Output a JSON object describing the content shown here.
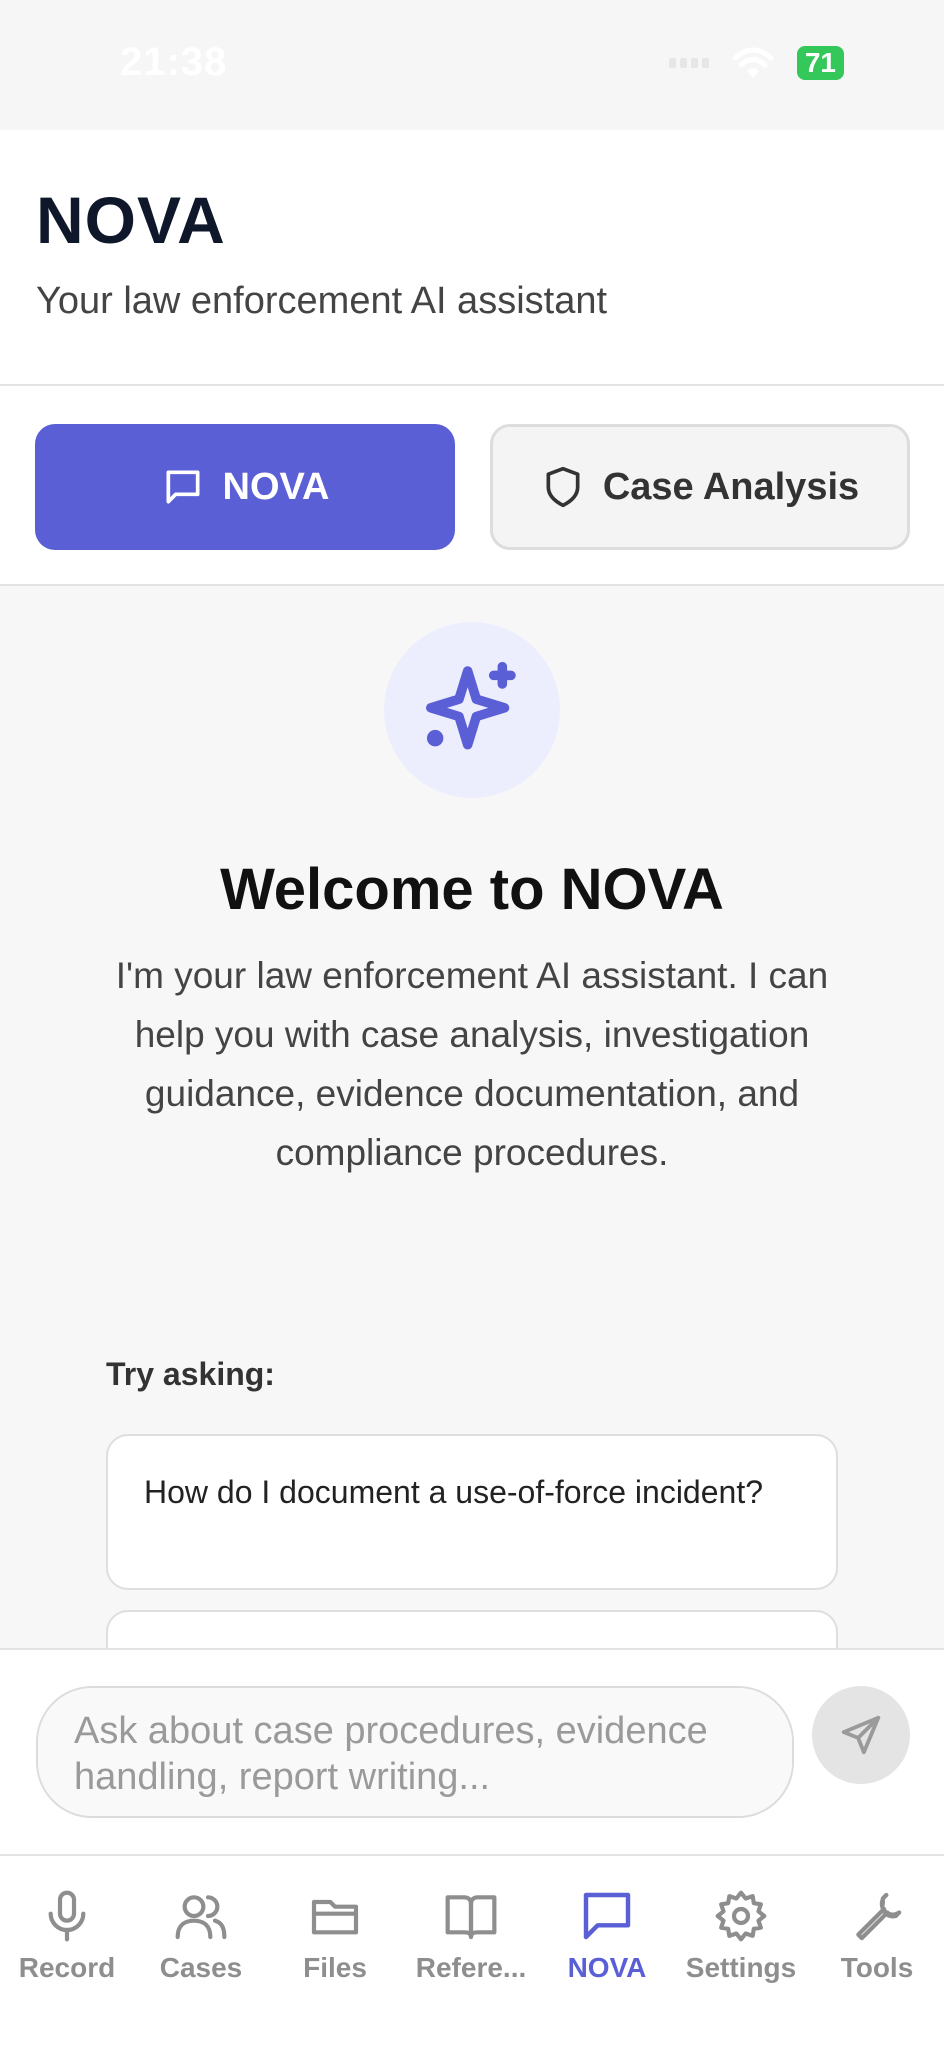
{
  "status_bar": {
    "time": "21:38",
    "battery": "71"
  },
  "header": {
    "title": "NOVA",
    "subtitle": "Your law enforcement AI assistant"
  },
  "tabs": [
    {
      "label": "NOVA",
      "icon": "chat-bubble-icon",
      "active": true
    },
    {
      "label": "Case Analysis",
      "icon": "shield-icon",
      "active": false
    }
  ],
  "welcome": {
    "title": "Welcome to NOVA",
    "text": "I'm your law enforcement AI assistant. I can help you with case analysis, investigation guidance, evidence documentation, and compliance procedures."
  },
  "suggestions": {
    "label": "Try asking:",
    "items": [
      "How do I document a use-of-force incident?",
      ""
    ]
  },
  "chat_input": {
    "placeholder": "Ask about case procedures, evidence handling, report writing..."
  },
  "bottom_nav": [
    {
      "label": "Record",
      "icon": "microphone-icon"
    },
    {
      "label": "Cases",
      "icon": "users-icon"
    },
    {
      "label": "Files",
      "icon": "folder-icon"
    },
    {
      "label": "Refere...",
      "icon": "book-icon"
    },
    {
      "label": "NOVA",
      "icon": "chat-bubble-icon",
      "active": true
    },
    {
      "label": "Settings",
      "icon": "gear-icon"
    },
    {
      "label": "Tools",
      "icon": "wrench-icon"
    }
  ],
  "colors": {
    "accent": "#5b5fd6",
    "accent_light": "#eceefd",
    "inactive": "#8e8e8e"
  }
}
